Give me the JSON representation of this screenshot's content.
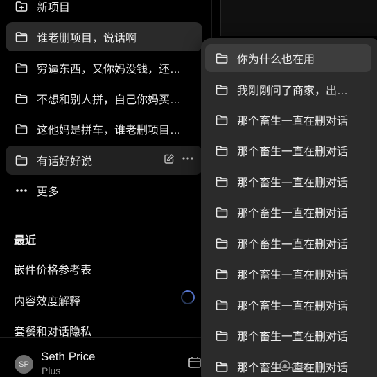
{
  "sidebar": {
    "new_project": {
      "label": "新项目",
      "icon": "folder-plus-icon"
    },
    "projects": [
      {
        "label": "谁老删项目，说话啊",
        "icon": "folder-icon",
        "state": "selected"
      },
      {
        "label": "穷逼东西，又你妈没钱，还…",
        "icon": "folder-icon"
      },
      {
        "label": "不想和别人拼，自己你妈买…",
        "icon": "folder-icon"
      },
      {
        "label": "这他妈是拼车，谁老删项目…",
        "icon": "folder-icon"
      },
      {
        "label": "有话好好说",
        "icon": "folder-icon",
        "state": "hovered",
        "actions": [
          "edit-icon",
          "more-icon"
        ]
      }
    ],
    "more": {
      "label": "更多",
      "icon": "more-horizontal-icon"
    },
    "recent_title": "最近",
    "recent": [
      "嵌件价格参考表",
      "内容效度解释",
      "套餐和对话隐私"
    ],
    "user": {
      "avatar_initials": "SP",
      "name": "Seth Price",
      "plan": "Plus"
    }
  },
  "context_menu": {
    "items": [
      {
        "label": "你为什么也在用",
        "icon": "folder-icon",
        "state": "active"
      },
      {
        "label": "我刚刚问了商家，出…",
        "icon": "folder-icon"
      },
      {
        "label": "那个畜生一直在删对话",
        "icon": "folder-icon"
      },
      {
        "label": "那个畜生一直在删对话",
        "icon": "folder-icon"
      },
      {
        "label": "那个畜生一直在删对话",
        "icon": "folder-icon"
      },
      {
        "label": "那个畜生一直在删对话",
        "icon": "folder-icon"
      },
      {
        "label": "那个畜生一直在删对话",
        "icon": "folder-icon"
      },
      {
        "label": "那个畜生一直在删对话",
        "icon": "folder-icon"
      },
      {
        "label": "那个畜生一直在删对话",
        "icon": "folder-icon"
      },
      {
        "label": "那个畜生一直在删对话",
        "icon": "folder-icon"
      },
      {
        "label": "那个畜生一直在删对话",
        "icon": "folder-icon"
      }
    ]
  },
  "watermark": {
    "text": "选择"
  },
  "colors": {
    "background": "#000000",
    "selected": "#2a2a2a",
    "menu": "#2b2b2b",
    "menu_active": "#3d3d3d",
    "spinner": "#5b7bd8"
  }
}
